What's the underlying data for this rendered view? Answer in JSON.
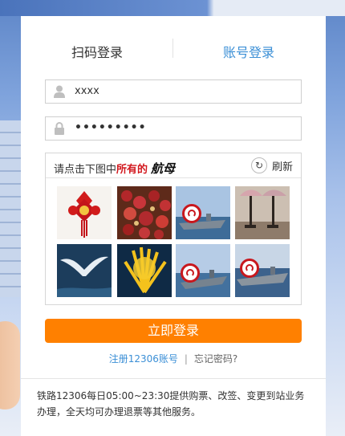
{
  "tabs": {
    "qr_label": "扫码登录",
    "account_label": "账号登录"
  },
  "form": {
    "username_value": "xxxx",
    "password_value": "•••••••••"
  },
  "captcha": {
    "prompt_prefix": "请点击下图中",
    "prompt_highlight": "所有的",
    "prompt_word": "航母",
    "refresh_label": "刷新",
    "images": [
      "chinese-knot",
      "red-seeds",
      "aircraft-carrier",
      "candlesticks",
      "seabird",
      "yellow-worm",
      "aircraft-carrier",
      "aircraft-carrier"
    ],
    "selected_indices": [
      2,
      6,
      7
    ]
  },
  "login_button_label": "立即登录",
  "links": {
    "register": "注册12306账号",
    "separator": "|",
    "forgot": "忘记密码?"
  },
  "notice": "铁路12306每日05:00~23:30提供购票、改签、变更到站业务办理，全天均可办理退票等其他服务。",
  "colors": {
    "accent": "#3b8fd6",
    "button": "#ff8000",
    "marker": "#c8171d"
  }
}
